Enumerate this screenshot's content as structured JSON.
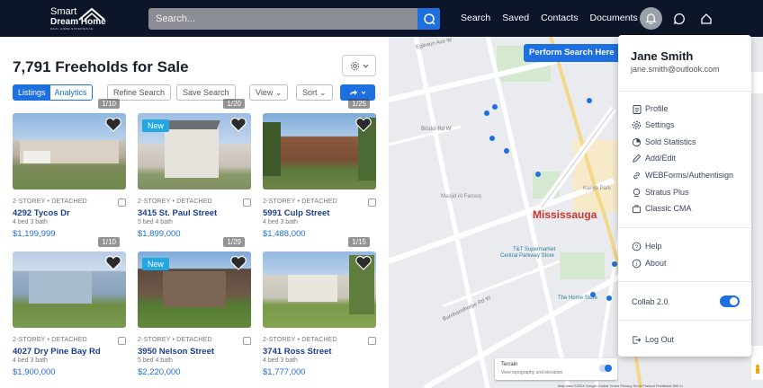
{
  "header": {
    "logo_line1": "Smart",
    "logo_line2": "Dream Home",
    "logo_tagline": "REAL HOME EXPERIENCE",
    "search_placeholder": "Search...",
    "nav": [
      "Search",
      "Saved",
      "Contacts",
      "Documents"
    ]
  },
  "listings": {
    "title": "7,791 Freeholds for Sale",
    "tabs": [
      "Listings",
      "Analytics"
    ],
    "refine_label": "Refine Search",
    "save_label": "Save Search",
    "view_label": "View",
    "sort_label": "Sort",
    "cards": [
      {
        "meta": "2-STOREY  •  DETACHED",
        "address": "4292 Tycos Dr",
        "beds": "4 bed 3 bath",
        "price": "$1,199,999",
        "count": "1/10",
        "badge": ""
      },
      {
        "meta": "2-STOREY  •  DETACHED",
        "address": "3415 St. Paul Street",
        "beds": "5 bed 4 bath",
        "price": "$1,899,000",
        "count": "1/20",
        "badge": "New"
      },
      {
        "meta": "2-STOREY  •  DETACHED",
        "address": "5991 Culp Street",
        "beds": "4 bed 3 bath",
        "price": "$1,488,000",
        "count": "1/25",
        "badge": ""
      },
      {
        "meta": "2-STOREY  •  DETACHED",
        "address": "4027 Dry Pine Bay Rd",
        "beds": "4 bed 3 bath",
        "price": "$1,900,000",
        "count": "1/10",
        "badge": ""
      },
      {
        "meta": "2-STOREY  •  DETACHED",
        "address": "3950 Nelson Street",
        "beds": "5 bed 4 bath",
        "price": "$2,220,000",
        "count": "1/29",
        "badge": "New"
      },
      {
        "meta": "2-STOREY  •  DETACHED",
        "address": "3741 Ross Street",
        "beds": "4 bed 3 bath",
        "price": "$1,777,000",
        "count": "1/15",
        "badge": ""
      }
    ]
  },
  "map": {
    "perform_label": "Perform Search Here",
    "city": "Mississauga",
    "labels": [
      "Masjid Al Farooq",
      "T&T Supermarket",
      "Central Parkway Store",
      "The Home Store",
      "Kariya Park",
      "Burnhamthorpe Rd W",
      "Eglinton Ave W",
      "Mavis Rd",
      "Bristol Rd W",
      "Central Pkwy W",
      "Confederation Pkwy"
    ],
    "terrain_title": "Terrain",
    "terrain_sub": "View topography and elevation",
    "footer": "Map data ©2024 Google   Global   Terms   Privacy   Send Product Feedback   500 m"
  },
  "profile_menu": {
    "name": "Jane Smith",
    "email": "jane.smith@outlook.com",
    "items": [
      "Profile",
      "Settings",
      "Sold Statistics",
      "Add/Edit",
      "WEBForms/Authentisign",
      "Stratus Plus",
      "Classic CMA"
    ],
    "help": "Help",
    "about": "About",
    "collab": "Collab 2.0",
    "logout": "Log Out"
  },
  "colors": {
    "accent": "#1e6fe0",
    "topbar": "#0d1528",
    "city": "#d0352b"
  }
}
